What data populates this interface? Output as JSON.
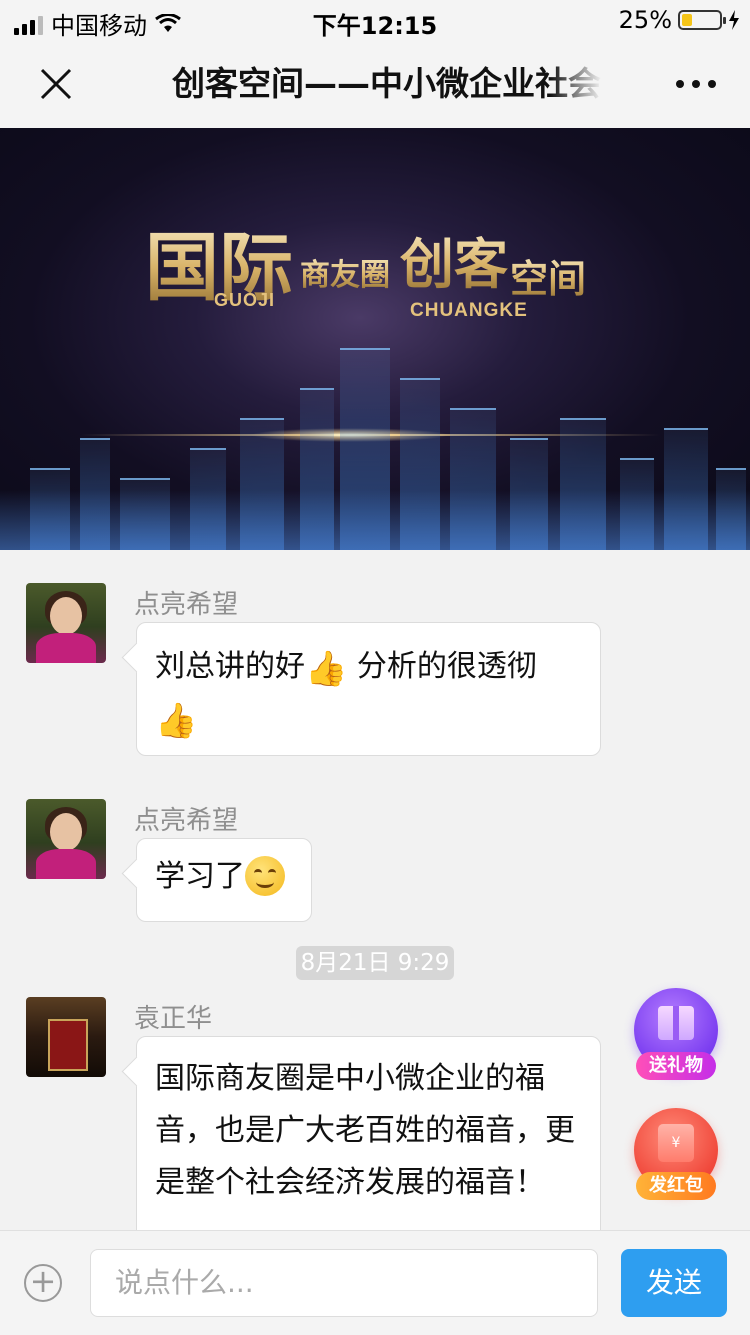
{
  "status_bar": {
    "carrier": "中国移动",
    "time": "下午12:15",
    "battery": "25%"
  },
  "nav": {
    "title": "创客空间——中小微企业社会"
  },
  "banner": {
    "word1": "国际",
    "word2": "商友圈",
    "word3": "创客",
    "word4": "空间",
    "sub1": "GUOJI",
    "sub2": "CHUANGKE"
  },
  "messages": [
    {
      "sender": "点亮希望",
      "text": "刘总讲的好",
      "text2": " 分析的很透彻"
    },
    {
      "sender": "点亮希望",
      "text": "学习了"
    },
    {
      "sender": "袁正华",
      "text": "国际商友圈是中小微企业的福音，也是广大老百姓的福音，更是整个社会经济发展的福音！"
    }
  ],
  "timestamp": "8月21日 9:29",
  "fabs": {
    "gift_label": "送礼物",
    "redpacket_label": "发红包",
    "redpacket_symbol": "¥"
  },
  "input_bar": {
    "placeholder": "说点什么...",
    "send_label": "发送"
  }
}
